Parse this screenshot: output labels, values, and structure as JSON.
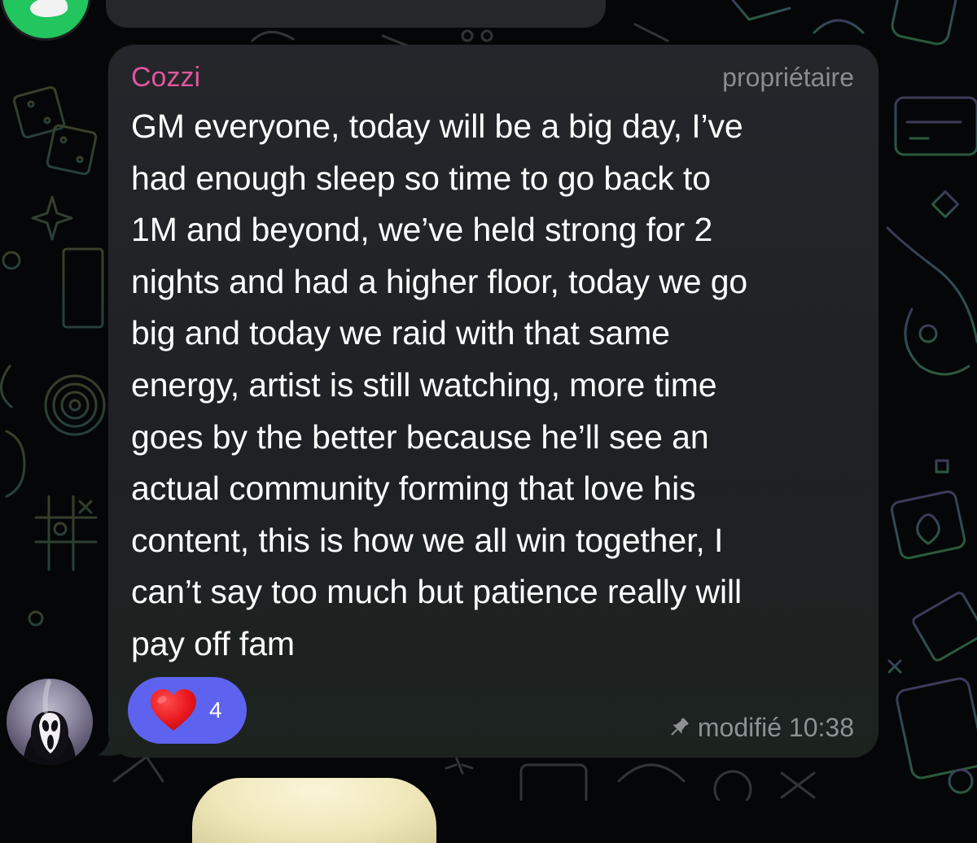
{
  "message": {
    "sender_name": "Cozzi",
    "role": "propriétaire",
    "text": "GM everyone, today will be a big day, I’ve\nhad enough sleep so time to go back to\n1M and beyond, we’ve held strong for 2\nnights and had a higher floor, today we go\nbig and today we raid with that same\nenergy, artist is still watching, more time\ngoes by the better because he’ll see an\nactual community forming that love his\ncontent, this is how we all win together, I\ncan’t say too much but patience really will\npay off fam",
    "reaction": {
      "icon": "heart-icon",
      "count": "4",
      "color": "#5e63ef"
    },
    "meta": {
      "pin_icon": "pin-icon",
      "label": "modifié 10:38"
    }
  },
  "colors": {
    "sender_name": "#e0569d",
    "bubble_background": "#25262b",
    "reaction_pill": "#5e63ef",
    "heart": "#e8191f"
  }
}
